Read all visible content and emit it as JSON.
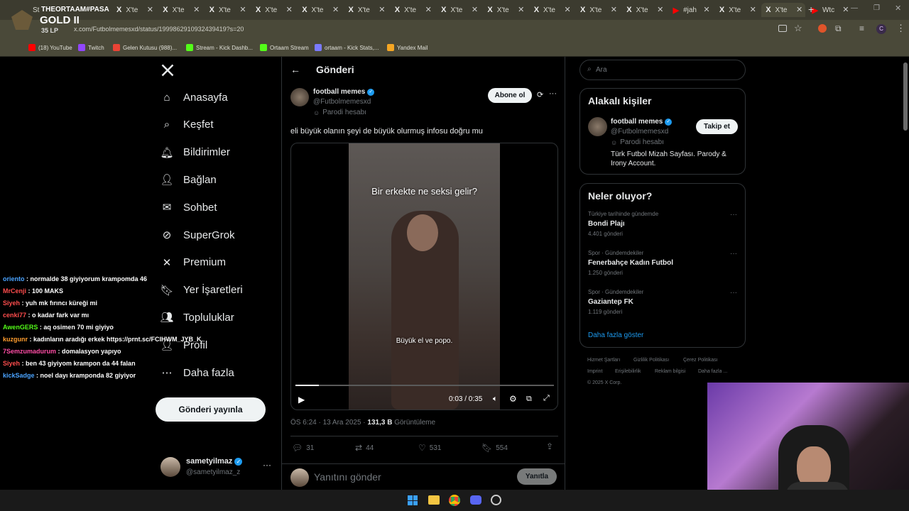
{
  "browser": {
    "tabs": [
      {
        "label": "X'te",
        "active": false
      },
      {
        "label": "X'te",
        "active": false
      },
      {
        "label": "X'te",
        "active": false
      },
      {
        "label": "X'te",
        "active": false
      },
      {
        "label": "X'te",
        "active": false
      },
      {
        "label": "X'te",
        "active": false
      },
      {
        "label": "X'te",
        "active": false
      },
      {
        "label": "X'te",
        "active": false
      },
      {
        "label": "X'te",
        "active": false
      },
      {
        "label": "X'te",
        "active": false
      },
      {
        "label": "X'te",
        "active": false
      },
      {
        "label": "X'te",
        "active": false
      },
      {
        "label": "#jah",
        "active": false
      },
      {
        "label": "X'te",
        "active": false
      },
      {
        "label": "X'te",
        "active": true
      },
      {
        "label": "Wtc",
        "active": false
      }
    ],
    "first_tab": "St",
    "url": "x.com/Futbolmemesxd/status/1999862910932439419?s=20",
    "bookmarks": [
      {
        "label": "(18) YouTube",
        "color": "#ff0000"
      },
      {
        "label": "Twitch",
        "color": "#9146ff"
      },
      {
        "label": "Gelen Kutusu (988)...",
        "color": "#ea4335"
      },
      {
        "label": "Stream - Kick Dashb...",
        "color": "#53fc18"
      },
      {
        "label": "Ortaam Stream",
        "color": "#53fc18"
      },
      {
        "label": "ortaam - Kick Stats,...",
        "color": "#7a7aff"
      },
      {
        "label": "Yandex Mail",
        "color": "#f5a623"
      }
    ]
  },
  "overlay": {
    "name": "THEORTAAM#PASA",
    "tier": "GOLD II",
    "lp": "35 LP"
  },
  "nav": {
    "items": [
      {
        "label": "Anasayfa",
        "icon": "home-icon"
      },
      {
        "label": "Keşfet",
        "icon": "search-icon"
      },
      {
        "label": "Bildirimler",
        "icon": "bell-icon"
      },
      {
        "label": "Bağlan",
        "icon": "add-person-icon"
      },
      {
        "label": "Sohbet",
        "icon": "mail-icon"
      },
      {
        "label": "SuperGrok",
        "icon": "grok-icon"
      },
      {
        "label": "Premium",
        "icon": "x-icon"
      },
      {
        "label": "Yer İşaretleri",
        "icon": "bookmark-icon"
      },
      {
        "label": "Topluluklar",
        "icon": "people-icon"
      },
      {
        "label": "Profil",
        "icon": "person-icon"
      },
      {
        "label": "Daha fazla",
        "icon": "more-circle-icon"
      }
    ],
    "post_button": "Gönderi yayınla",
    "account": {
      "name": "sametyilmaz",
      "handle": "@sametyilmaz_z"
    }
  },
  "post": {
    "header_title": "Gönderi",
    "author_name": "football memes",
    "author_handle": "@Futbolmemesxd",
    "parody_label": "Parodi hesabı",
    "follow_label": "Abone ol",
    "text": "eli büyük olanın şeyi de büyük olurmuş infosu doğru mu",
    "video": {
      "caption_top": "Bir erkekte ne seksi gelir?",
      "caption_bottom": "Büyük el ve popo.",
      "time": "0:03 / 0:35",
      "progress": 0.09
    },
    "meta_time": "ÖS 6:24 · 13 Ara 2025 · ",
    "views": "131,3 B",
    "views_label": " Görüntüleme",
    "stats": {
      "replies": "31",
      "reposts": "44",
      "likes": "531",
      "bookmarks": "554"
    },
    "reply_placeholder": "Yanıtını gönder",
    "reply_button": "Yanıtla"
  },
  "sidebar": {
    "search_placeholder": "Ara",
    "relevant_title": "Alakalı kişiler",
    "relevant": {
      "name": "football memes",
      "handle": "@Futbolmemesxd",
      "parody": "Parodi hesabı",
      "bio": "Türk Futbol Mizah Sayfası. Parody & Irony Account.",
      "follow": "Takip et"
    },
    "trends_title": "Neler oluyor?",
    "trends": [
      {
        "context": "Türkiye tarihinde gündemde",
        "name": "Bondi Plajı",
        "count": "4.401 gönderi"
      },
      {
        "context": "Spor · Gündemdekiler",
        "name": "Fenerbahçe Kadın Futbol",
        "count": "1.250 gönderi"
      },
      {
        "context": "Spor · Gündemdekiler",
        "name": "Gaziantep FK",
        "count": "1.119 gönderi"
      }
    ],
    "show_more": "Daha fazla göster",
    "footer": [
      "Hizmet Şartları",
      "Gizlilik Politikası",
      "Çerez Politikası",
      "Imprint",
      "Erişilebilirlik",
      "Reklam bilgisi",
      "Daha fazla ...",
      "© 2025 X Corp."
    ]
  },
  "chat": [
    {
      "user": "oriento",
      "color": "#4aa3ff",
      "msg": " : normalde 38 giyiyorum krampomda 46"
    },
    {
      "user": "MrCenji",
      "color": "#ff4d4d",
      "msg": " : 100 MAKS"
    },
    {
      "user": "Siyeh",
      "color": "#ff4d4d",
      "msg": " : yuh mk fırıncı küreği mi"
    },
    {
      "user": "cenki77",
      "color": "#ff4d4d",
      "msg": " : o kadar fark var mı"
    },
    {
      "user": "AwenGERS",
      "color": "#53fc18",
      "msg": " : aq osimen 70 mi giyiyo"
    },
    {
      "user": "kuzgunr",
      "color": "#ff9d2e",
      "msg": " : kadınların aradığı erkek https://prnt.sc/FCIHWM_JYB_K"
    },
    {
      "user": "7Semzumadurum",
      "color": "#ff4da6",
      "msg": " : domalasyon yapıyo"
    },
    {
      "user": "Siyeh",
      "color": "#ff4d4d",
      "msg": " : ben 43 giyiyom krampon da 44 falan"
    },
    {
      "user": "kickSadge",
      "color": "#4aa3ff",
      "msg": " : noel dayı kramponda 82 giyiyor"
    }
  ]
}
